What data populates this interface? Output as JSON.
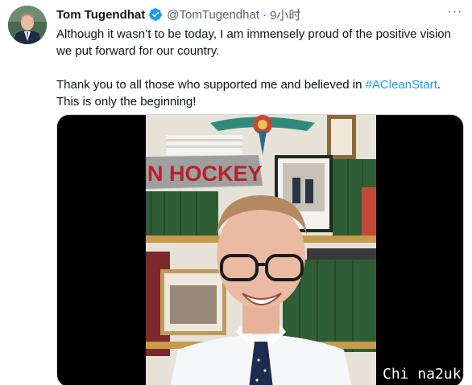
{
  "tweet": {
    "author_name": "Tom Tugendhat",
    "verified_icon": "verified-badge-icon",
    "handle": "@TomTugendhat",
    "separator": "·",
    "time": "9小时",
    "more_icon": "more-icon",
    "paragraph1": "Although it wasn’t to be today, I am immensely proud of the positive vision we put forward for our country.",
    "paragraph2_prefix": "Thank you to all those who supported me and believed in ",
    "hashtag": "#ACleanStart",
    "paragraph2_suffix": ".",
    "paragraph3": "This is only the beginning!",
    "media": {
      "sign_text": "N HOCKEY"
    }
  },
  "watermark": "Chi na2uk",
  "colors": {
    "link": "#1d9bf0",
    "verified": "#1d9bf0",
    "secondary_text": "#536471"
  }
}
